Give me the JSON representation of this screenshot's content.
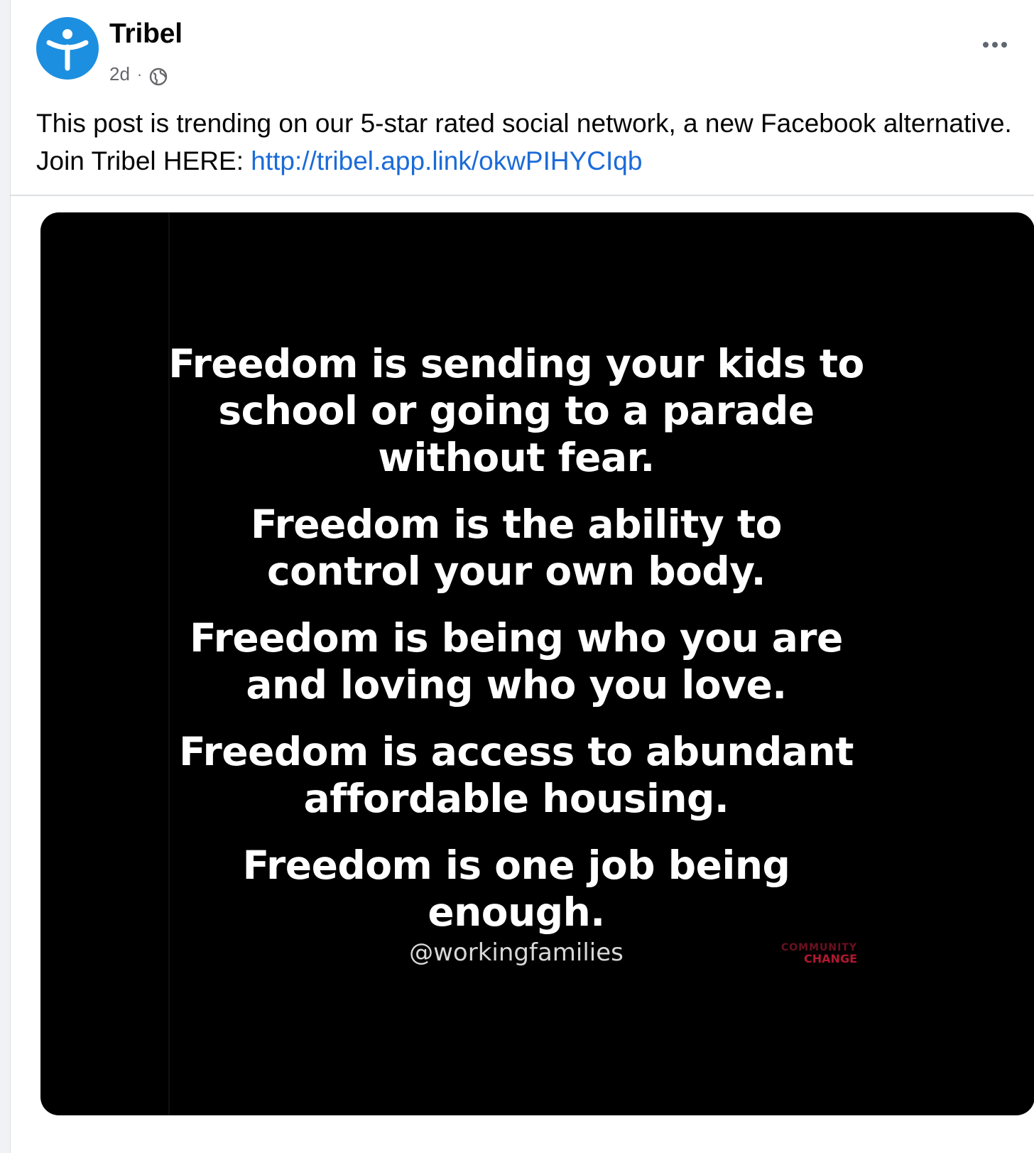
{
  "post": {
    "author": "Tribel",
    "time": "2d",
    "separator": "·",
    "icons": {
      "avatar": "tribel-logo-icon",
      "audience": "globe-icon",
      "menu": "more-options-icon"
    },
    "caption_text": "This post is trending on our 5-star rated social network, a new Facebook alternative. Join Tribel HERE: ",
    "caption_link": "http://tribel.app.link/okwPIHYCIqb"
  },
  "image": {
    "quotes": [
      "Freedom is sending your kids to school or going to a parade without fear.",
      "Freedom is the ability to control your own body.",
      "Freedom is being who you are and loving who you love.",
      "Freedom is access to abundant affordable housing.",
      "Freedom is one job being enough."
    ],
    "handle": "@workingfamilies",
    "watermark_top": "COMMUNITY",
    "watermark_bottom": "CHANGE"
  },
  "colors": {
    "avatar_bg": "#1d8fe0",
    "link": "#1a6bd8",
    "image_bg": "#000000",
    "watermark": "#b01830"
  }
}
